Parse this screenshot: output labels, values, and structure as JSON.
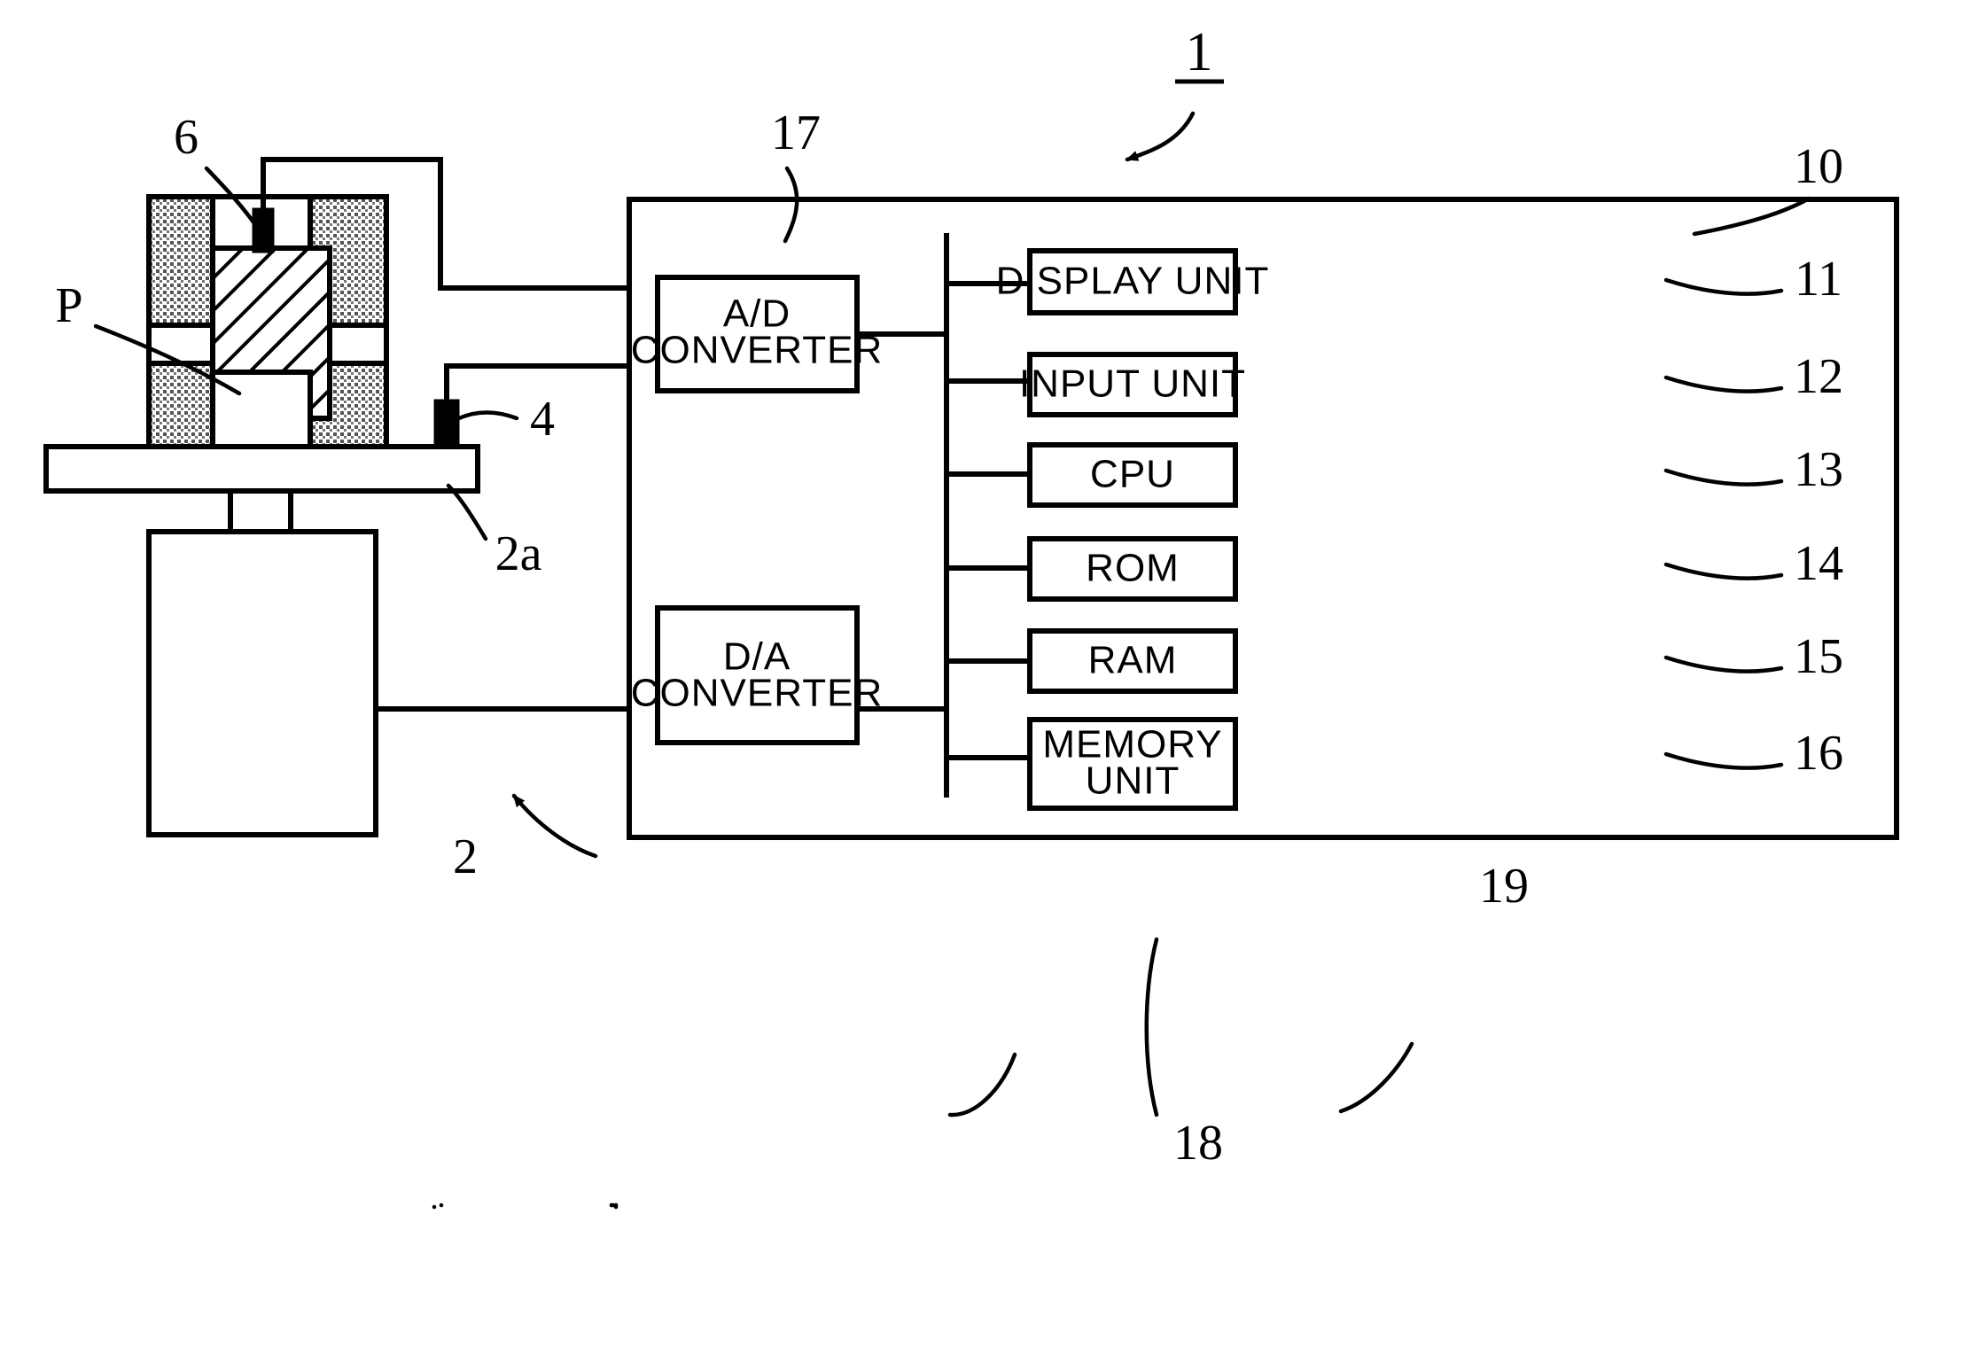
{
  "figure": {
    "title": "1",
    "title_underlined": true,
    "domain_kind": "patent-block-diagram"
  },
  "apparatus": {
    "specimen_label": "P",
    "table_label": "2a",
    "actuator_label": "2",
    "upper_sensor_label": "6",
    "lower_sensor_label": "4"
  },
  "control_unit": {
    "ref": "10",
    "bus_ref": "19",
    "converters": [
      {
        "ref": "17",
        "line1": "A/D",
        "line2": "CONVERTER"
      },
      {
        "ref": "18",
        "line1": "D/A",
        "line2": "CONVERTER"
      }
    ],
    "modules": [
      {
        "ref": "11",
        "label": "DISPLAY UNIT",
        "line1": "DISPLAY UNIT",
        "line2": ""
      },
      {
        "ref": "12",
        "label": "INPUT UNIT",
        "line1": "INPUT UNIT",
        "line2": ""
      },
      {
        "ref": "13",
        "label": "CPU",
        "line1": "CPU",
        "line2": ""
      },
      {
        "ref": "14",
        "label": "ROM",
        "line1": "ROM",
        "line2": ""
      },
      {
        "ref": "15",
        "label": "RAM",
        "line1": "RAM",
        "line2": ""
      },
      {
        "ref": "16",
        "label": "MEMORY UNIT",
        "line1": "MEMORY",
        "line2": "UNIT"
      }
    ]
  },
  "colors": {
    "ink": "#000000",
    "paper": "#ffffff"
  }
}
